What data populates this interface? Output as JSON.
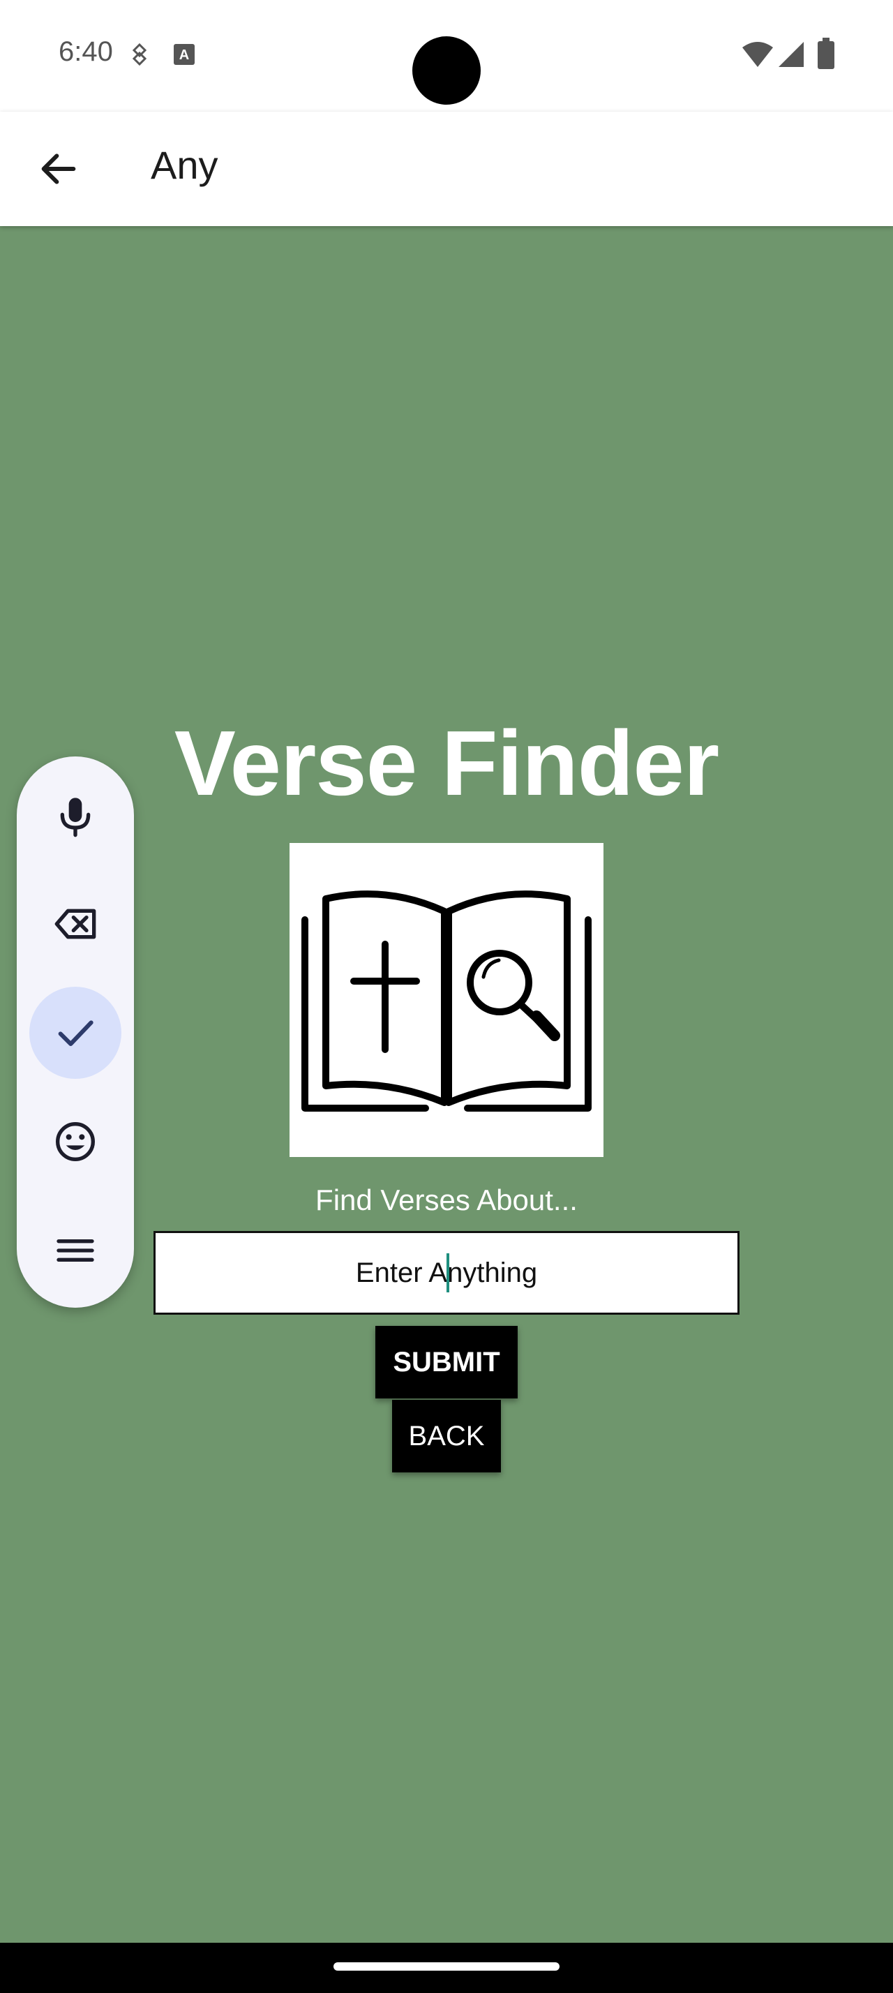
{
  "status_bar": {
    "time": "6:40"
  },
  "app_bar": {
    "title": "Any"
  },
  "main": {
    "title": "Verse Finder",
    "prompt": "Find Verses About...",
    "search": {
      "value": "Enter Anything"
    },
    "submit_label": "SUBMIT",
    "back_label": "BACK"
  },
  "keyboard_toolbar": {
    "buttons": [
      "mic-icon",
      "backspace-icon",
      "check-icon",
      "emoji-icon",
      "menu-icon"
    ],
    "active": "check-icon"
  },
  "colors": {
    "background": "#6f966d",
    "accent": "#d8e0fb",
    "caret": "#1f8f7f"
  }
}
